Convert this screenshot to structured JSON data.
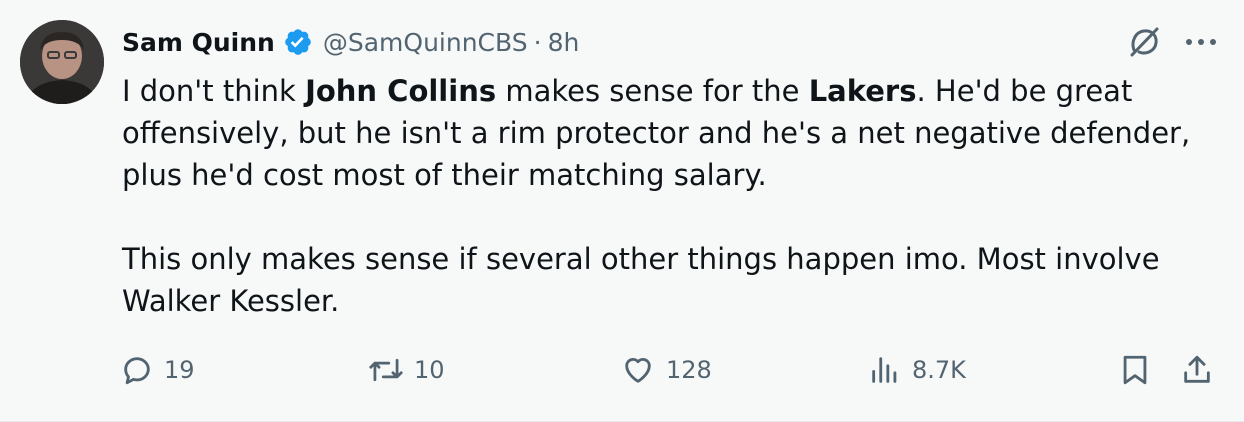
{
  "author": {
    "name": "Sam Quinn",
    "handle": "@SamQuinnCBS",
    "separator": "·",
    "time": "8h",
    "verified": true
  },
  "tweet": {
    "p1_a": "I don't think ",
    "p1_b": "John Collins",
    "p1_c": " makes sense for the ",
    "p1_d": "Lakers",
    "p1_e": ". He'd be great offensively, but he isn't a rim protector and he's a net negative defender, plus he'd cost most of their matching salary.",
    "p2": "This only makes sense if several other things happen imo. Most involve Walker Kessler."
  },
  "metrics": {
    "replies": "19",
    "reposts": "10",
    "likes": "128",
    "views": "8.7K"
  },
  "icons": {
    "verified": "verified-badge-icon",
    "grok": "grok-icon",
    "more": "more-icon",
    "reply": "reply-icon",
    "repost": "repost-icon",
    "like": "heart-icon",
    "views": "views-icon",
    "bookmark": "bookmark-icon",
    "share": "share-icon"
  },
  "colors": {
    "verified": "#1d9bf0",
    "muted": "#536471",
    "text": "#0f1419",
    "background": "#f7f9f9"
  }
}
